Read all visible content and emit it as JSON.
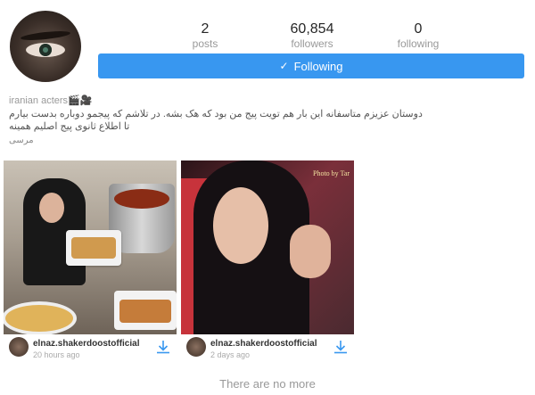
{
  "profile": {
    "stats": [
      {
        "value": "2",
        "label": "posts"
      },
      {
        "value": "60,854",
        "label": "followers"
      },
      {
        "value": "0",
        "label": "following"
      }
    ],
    "follow_button": {
      "label": "Following",
      "icon": "check-icon",
      "color": "#3897f0"
    },
    "bio": {
      "name": "iranian acters🎬🎥",
      "line1": "دوستان عزیزم متاسفانه این بار هم تویت پیج من بود که هک بشه. در تلاشم که پیجمو دوباره بدست بیارم",
      "line2": "تا اطلاع ثانوی پیج اصلیم همینه",
      "line3": "مرسی"
    }
  },
  "posts": [
    {
      "username": "elnaz.shakerdoostofficial",
      "time": "20 hours ago",
      "action_icon": "download-icon"
    },
    {
      "username": "elnaz.shakerdoostofficial",
      "time": "2 days ago",
      "action_icon": "download-icon",
      "watermark": "Photo by  Tar"
    }
  ],
  "footer": {
    "text": "There are no more"
  }
}
